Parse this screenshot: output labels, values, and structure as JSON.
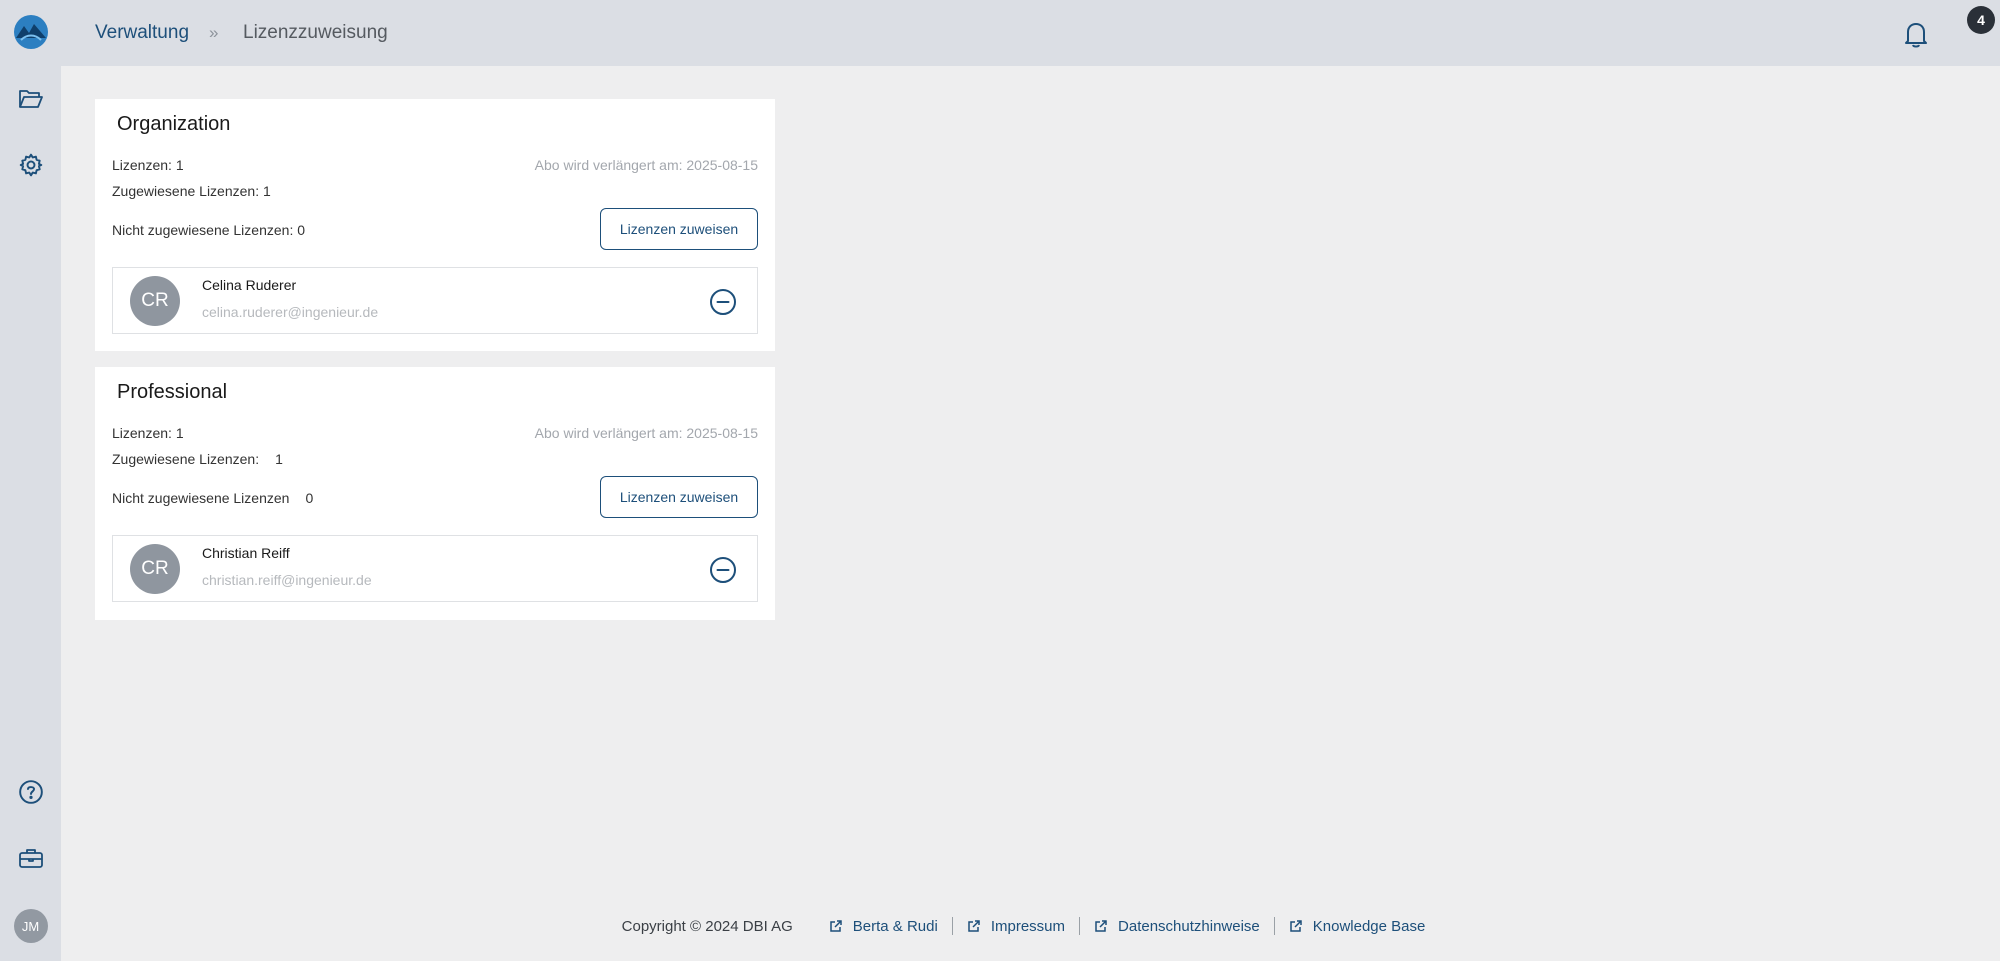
{
  "header": {
    "breadcrumb_root": "Verwaltung",
    "breadcrumb_separator": "»",
    "breadcrumb_current": "Lizenzzuweisung",
    "notification_count": "4"
  },
  "sidebar": {
    "user_initials": "JM",
    "icons": [
      "logo-icon",
      "folder-open-icon",
      "gear-icon",
      "help-icon",
      "toolbox-icon"
    ]
  },
  "cards": [
    {
      "title": "Organization",
      "licenses": "Lizenzen: 1",
      "assigned": "Zugewiesene Lizenzen: 1",
      "unassigned_label": "Nicht zugewiesene Lizenzen: 0",
      "unassigned_value": "",
      "renewal": "Abo wird verlängert am: 2025-08-15",
      "button": "Lizenzen zuweisen",
      "user": {
        "initials": "CR",
        "name": "Celina Ruderer",
        "email": "celina.ruderer@ingenieur.de"
      }
    },
    {
      "title": "Professional",
      "licenses": "Lizenzen: 1",
      "assigned_label": "Zugewiesene Lizenzen:",
      "assigned_value": "1",
      "unassigned_label": "Nicht zugewiesene Lizenzen",
      "unassigned_value": "0",
      "renewal": "Abo wird verlängert am: 2025-08-15",
      "button": "Lizenzen zuweisen",
      "user": {
        "initials": "CR",
        "name": "Christian Reiff",
        "email": "christian.reiff@ingenieur.de"
      }
    }
  ],
  "footer": {
    "copyright": "Copyright © 2024 DBI AG",
    "links": [
      "Berta & Rudi",
      "Impressum",
      "Datenschutzhinweise",
      "Knowledge Base"
    ]
  },
  "colors": {
    "accent": "#1d4f7a",
    "sidebar_bg": "#dbdee4",
    "page_bg": "#eeeeef"
  }
}
